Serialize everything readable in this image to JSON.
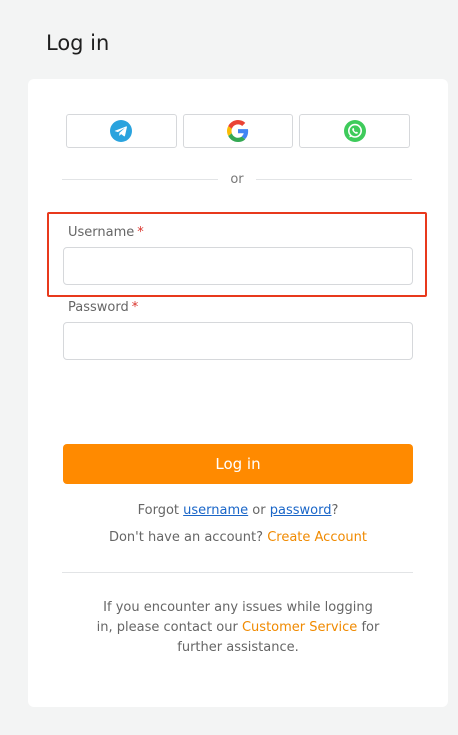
{
  "page": {
    "title": "Log in"
  },
  "social": {
    "buttons": [
      {
        "icon": "telegram-icon",
        "color": "#2AA3DE"
      },
      {
        "icon": "google-icon",
        "colors": [
          "#EA4335",
          "#FBBC05",
          "#34A853",
          "#4285F4"
        ]
      },
      {
        "icon": "whatsapp-icon",
        "color": "#3ECB5B"
      }
    ]
  },
  "divider": {
    "text": "or"
  },
  "form": {
    "username_label": "Username",
    "username_value": "",
    "password_label": "Password",
    "password_value": "",
    "required_mark": "*",
    "login_label": "Log in"
  },
  "links": {
    "forgot_prefix": "Forgot",
    "forgot_username": "username",
    "forgot_or": "or",
    "forgot_password": "password",
    "forgot_suffix": "?",
    "no_account": "Don't have an account?",
    "create_account": "Create Account"
  },
  "help": {
    "prefix": "If you encounter any issues while logging in, please contact our",
    "link": "Customer Service",
    "suffix": "for further assistance."
  },
  "colors": {
    "accent": "#FF8A00",
    "link_blue": "#1A66C8",
    "highlight": "#E8391C"
  }
}
